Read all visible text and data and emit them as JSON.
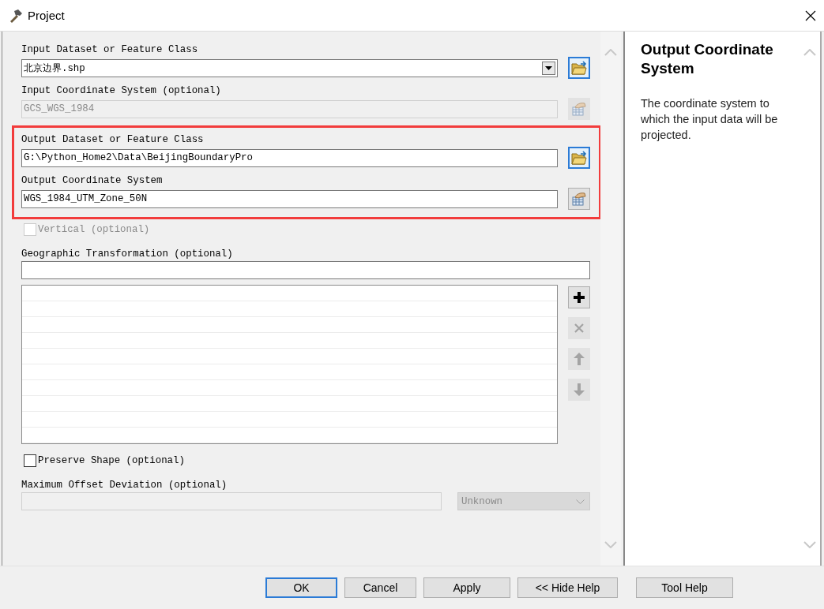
{
  "window": {
    "title": "Project"
  },
  "params": [
    {
      "kind": "combo",
      "label": "Input Dataset or Feature Class",
      "value": "北京边界.shp",
      "disabled": false,
      "highlighted": false,
      "button": {
        "kind": "folder",
        "disabled": false
      }
    },
    {
      "kind": "text",
      "label": "Input Coordinate System (optional)",
      "value": "GCS_WGS_1984",
      "disabled": true,
      "highlighted": false,
      "button": {
        "kind": "coordinate",
        "disabled": true
      }
    },
    {
      "kind": "text",
      "label": "Output Dataset or Feature Class",
      "value": "G:\\Python_Home2\\Data\\BeijingBoundaryPro",
      "disabled": false,
      "highlighted": true,
      "button": {
        "kind": "folder",
        "disabled": false
      }
    },
    {
      "kind": "text",
      "label": "Output Coordinate System",
      "value": "WGS_1984_UTM_Zone_50N",
      "disabled": false,
      "highlighted": true,
      "button": {
        "kind": "coordinate",
        "disabled": false
      }
    },
    {
      "kind": "checkbox",
      "label": "Vertical (optional)",
      "checked": false,
      "disabled": true,
      "highlighted": false
    },
    {
      "kind": "text",
      "label": "Geographic Transformation (optional)",
      "disabled": false,
      "highlighted": false
    },
    {
      "kind": "list",
      "highlighted": false,
      "tools": [
        {
          "kind": "add",
          "disabled": false
        },
        {
          "kind": "remove",
          "disabled": true
        },
        {
          "kind": "up",
          "disabled": true
        },
        {
          "kind": "down",
          "disabled": true
        }
      ]
    },
    {
      "kind": "checkbox",
      "label": "Preserve Shape (optional)",
      "checked": false,
      "disabled": false,
      "highlighted": false
    },
    {
      "kind": "unit",
      "label": "Maximum Offset Deviation (optional)",
      "unit": "Unknown",
      "disabled": true,
      "highlighted": false
    }
  ],
  "help": {
    "title": "Output Coordinate System",
    "text": "The coordinate system to which the input data will be projected."
  },
  "buttons": [
    {
      "label": "OK",
      "default": true
    },
    {
      "label": "Cancel",
      "default": false
    },
    {
      "label": "Apply",
      "default": false
    },
    {
      "label": "<< Hide Help",
      "default": false
    },
    {
      "label": "Tool Help",
      "default": false
    }
  ]
}
